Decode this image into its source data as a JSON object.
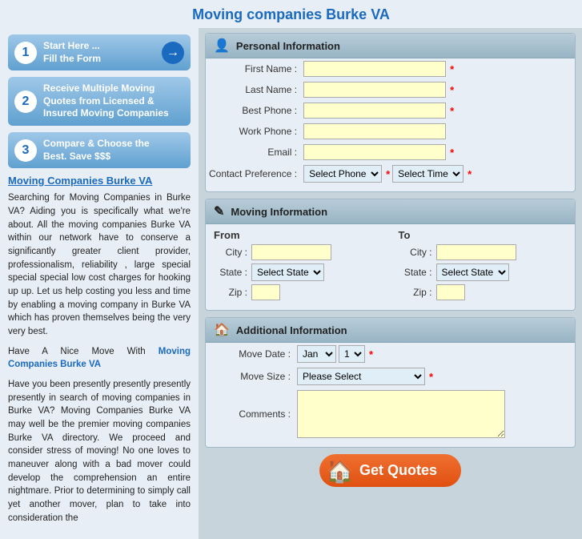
{
  "page": {
    "title": "Moving companies Burke VA"
  },
  "sidebar": {
    "step1": {
      "num": "1",
      "line1": "Start Here ...",
      "line2": "Fill the Form"
    },
    "step2": {
      "num": "2",
      "line1": "Receive Multiple Moving",
      "line2": "Quotes from Licensed &",
      "line3": "Insured Moving Companies"
    },
    "step3": {
      "num": "3",
      "line1": "Compare & Choose the",
      "line2_plain": "Best. ",
      "line2_bold": "Save $$$"
    },
    "link": "Moving Companies Burke VA",
    "para1": "Searching for Moving Companies in Burke VA? Aiding you is specifically what we're about. All the moving companies Burke VA within our network have to conserve a significantly greater client provider, professionalism, reliability , large special special special low cost charges for hooking up up. Let us help costing you less and time by enabling a moving company in Burke VA which has proven themselves being the very very best.",
    "para2_plain": "Have A Nice Move With ",
    "para2_bold": "Moving Companies Burke VA",
    "para3": "Have you been presently presently presently presently in search of moving companies in Burke VA? Moving Companies Burke VA may well be the premier moving companies Burke VA directory. We proceed and consider stress of moving! No one loves to maneuver along with a bad mover could develop the comprehension an entire nightmare. Prior to determining to simply call yet another mover, plan to take into consideration the"
  },
  "form": {
    "personal": {
      "header": "Personal Information",
      "first_name_label": "First Name :",
      "last_name_label": "Last Name :",
      "best_phone_label": "Best Phone :",
      "work_phone_label": "Work Phone :",
      "email_label": "Email :",
      "contact_pref_label": "Contact Preference :",
      "select_phone": "Select Phone",
      "select_time": "Select Time"
    },
    "moving": {
      "header": "Moving Information",
      "from_label": "From",
      "to_label": "To",
      "city_label": "City :",
      "state_label": "State :",
      "zip_label": "Zip :",
      "select_state_from": "Select State",
      "select_state_to": "Select State"
    },
    "additional": {
      "header": "Additional Information",
      "move_date_label": "Move Date :",
      "month_default": "Jan",
      "day_default": "1",
      "move_size_label": "Move Size :",
      "move_size_default": "Please Select",
      "comments_label": "Comments :"
    },
    "submit": {
      "label": "Get Quotes"
    }
  }
}
